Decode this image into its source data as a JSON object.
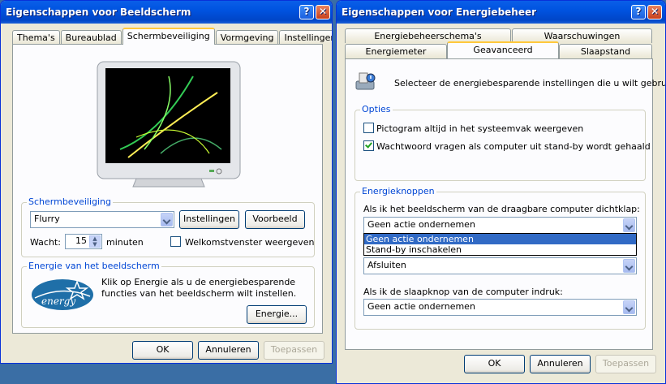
{
  "display": {
    "title": "Eigenschappen voor Beeldscherm",
    "tabs": [
      "Thema's",
      "Bureaublad",
      "Schermbeveiliging",
      "Vormgeving",
      "Instellingen"
    ],
    "screensaver_group": "Schermbeveiliging",
    "screensaver_value": "Flurry",
    "settings_button": "Instellingen",
    "preview_button": "Voorbeeld",
    "wait_label": "Wacht:",
    "wait_value": "15",
    "minutes_label": "minuten",
    "welcome_label": "Welkomstvenster weergeven",
    "welcome_checked": false,
    "energy_group": "Energie van het beeldscherm",
    "energy_text": "Klik op Energie als u de energiebesparende functies van het beeldscherm wilt instellen.",
    "energy_button": "Energie...",
    "energy_logo": "energy",
    "ok": "OK",
    "cancel": "Annuleren",
    "apply": "Toepassen"
  },
  "power": {
    "title": "Eigenschappen voor Energiebeheer",
    "tabs_row1": [
      "Energiebeheerschema's",
      "Waarschuwingen"
    ],
    "tabs_row2": [
      "Energiemeter",
      "Geavanceerd",
      "Slaapstand"
    ],
    "intro": "Selecteer de energiebesparende instellingen die u wilt gebruiken:",
    "options_group": "Opties",
    "option1": "Pictogram altijd in het systeemvak weergeven",
    "option1_checked": false,
    "option2": "Wachtwoord vragen als computer uit stand-by wordt gehaald",
    "option2_checked": true,
    "buttons_group": "Energieknoppen",
    "lid_label": "Als ik het beeldscherm van de draagbare computer dichtklap:",
    "lid_value": "Geen actie ondernemen",
    "dropdown_options": [
      "Geen actie ondernemen",
      "Stand-by inschakelen"
    ],
    "power_value": "Afsluiten",
    "sleep_label": "Als ik de slaapknop van de computer indruk:",
    "sleep_value": "Geen actie ondernemen",
    "ok": "OK",
    "cancel": "Annuleren",
    "apply": "Toepassen"
  }
}
